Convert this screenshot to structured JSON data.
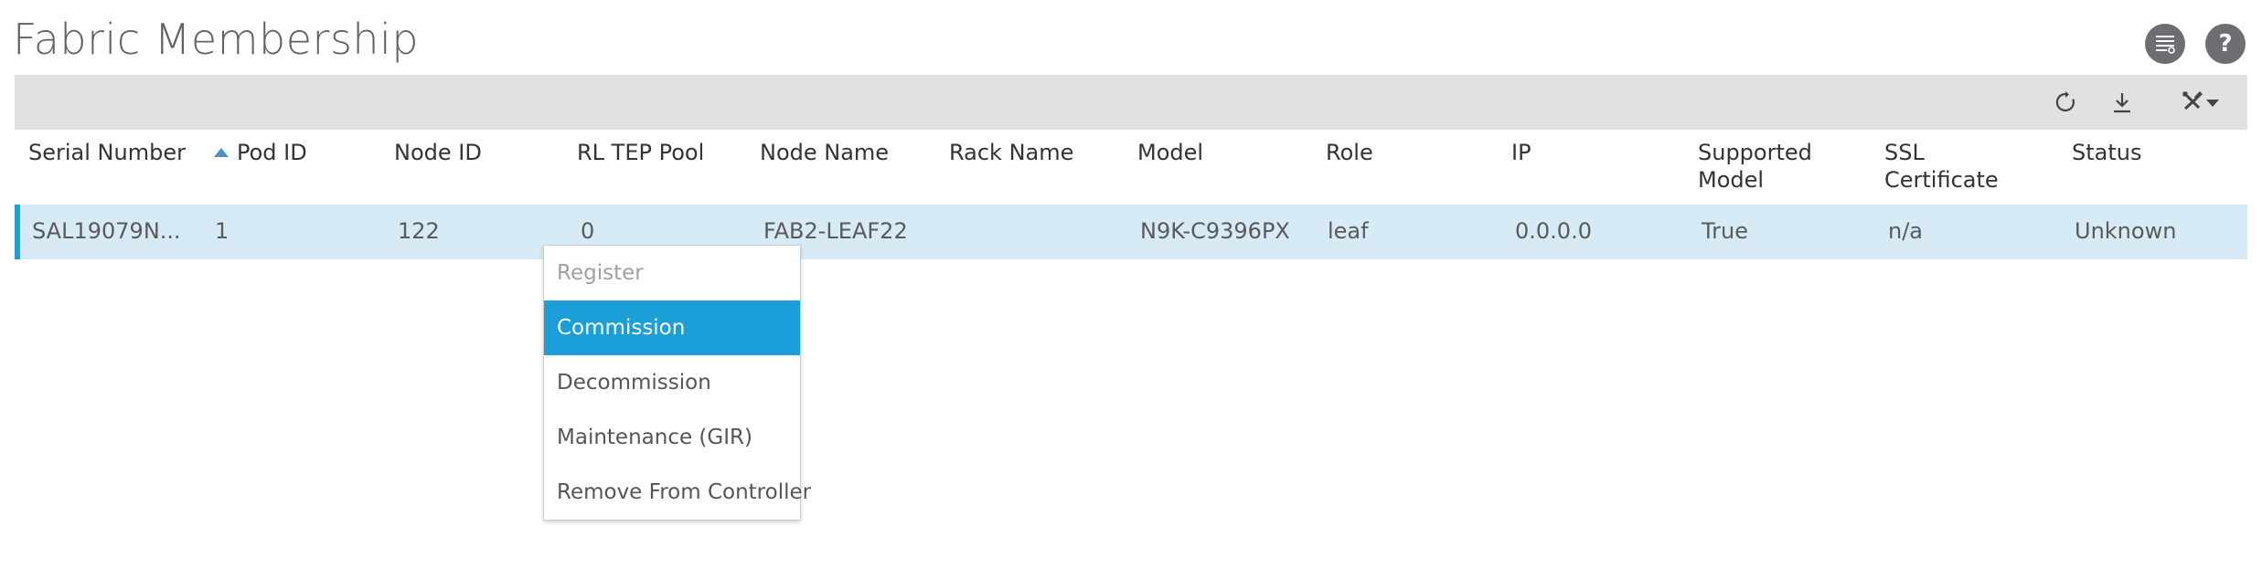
{
  "page": {
    "title": "Fabric Membership"
  },
  "colors": {
    "accent": "#1a9fd9",
    "row_selected": "#d6ebf5",
    "toolbar_bg": "#e1e1e1",
    "icon_bg": "#6d6e71"
  },
  "top_icons": [
    "list-settings-icon",
    "help-icon"
  ],
  "help_icon_glyph": "?",
  "toolbar": {
    "icons": [
      "refresh-icon",
      "download-icon",
      "tools-icon",
      "caret-down-icon"
    ]
  },
  "table": {
    "columns": [
      "Serial Number",
      "Pod ID",
      "Node ID",
      "RL TEP Pool",
      "Node Name",
      "Rack Name",
      "Model",
      "Role",
      "IP",
      "Supported Model",
      "SSL Certificate",
      "Status"
    ],
    "sorted_column": "Pod ID",
    "sort_direction": "ascending",
    "rows": [
      {
        "serial_number": "SAL19079N...",
        "pod_id": "1",
        "node_id": "122",
        "rl_tep_pool": "0",
        "node_name": "FAB2-LEAF22",
        "rack_name": "",
        "model": "N9K-C9396PX",
        "role": "leaf",
        "ip": "0.0.0.0",
        "supported_model": "True",
        "ssl_certificate": "n/a",
        "status": "Unknown"
      }
    ]
  },
  "context_menu": {
    "items": [
      {
        "label": "Register",
        "state": "disabled"
      },
      {
        "label": "Commission",
        "state": "selected"
      },
      {
        "label": "Decommission",
        "state": "normal"
      },
      {
        "label": "Maintenance (GIR)",
        "state": "normal"
      },
      {
        "label": "Remove From Controller",
        "state": "normal"
      }
    ]
  }
}
